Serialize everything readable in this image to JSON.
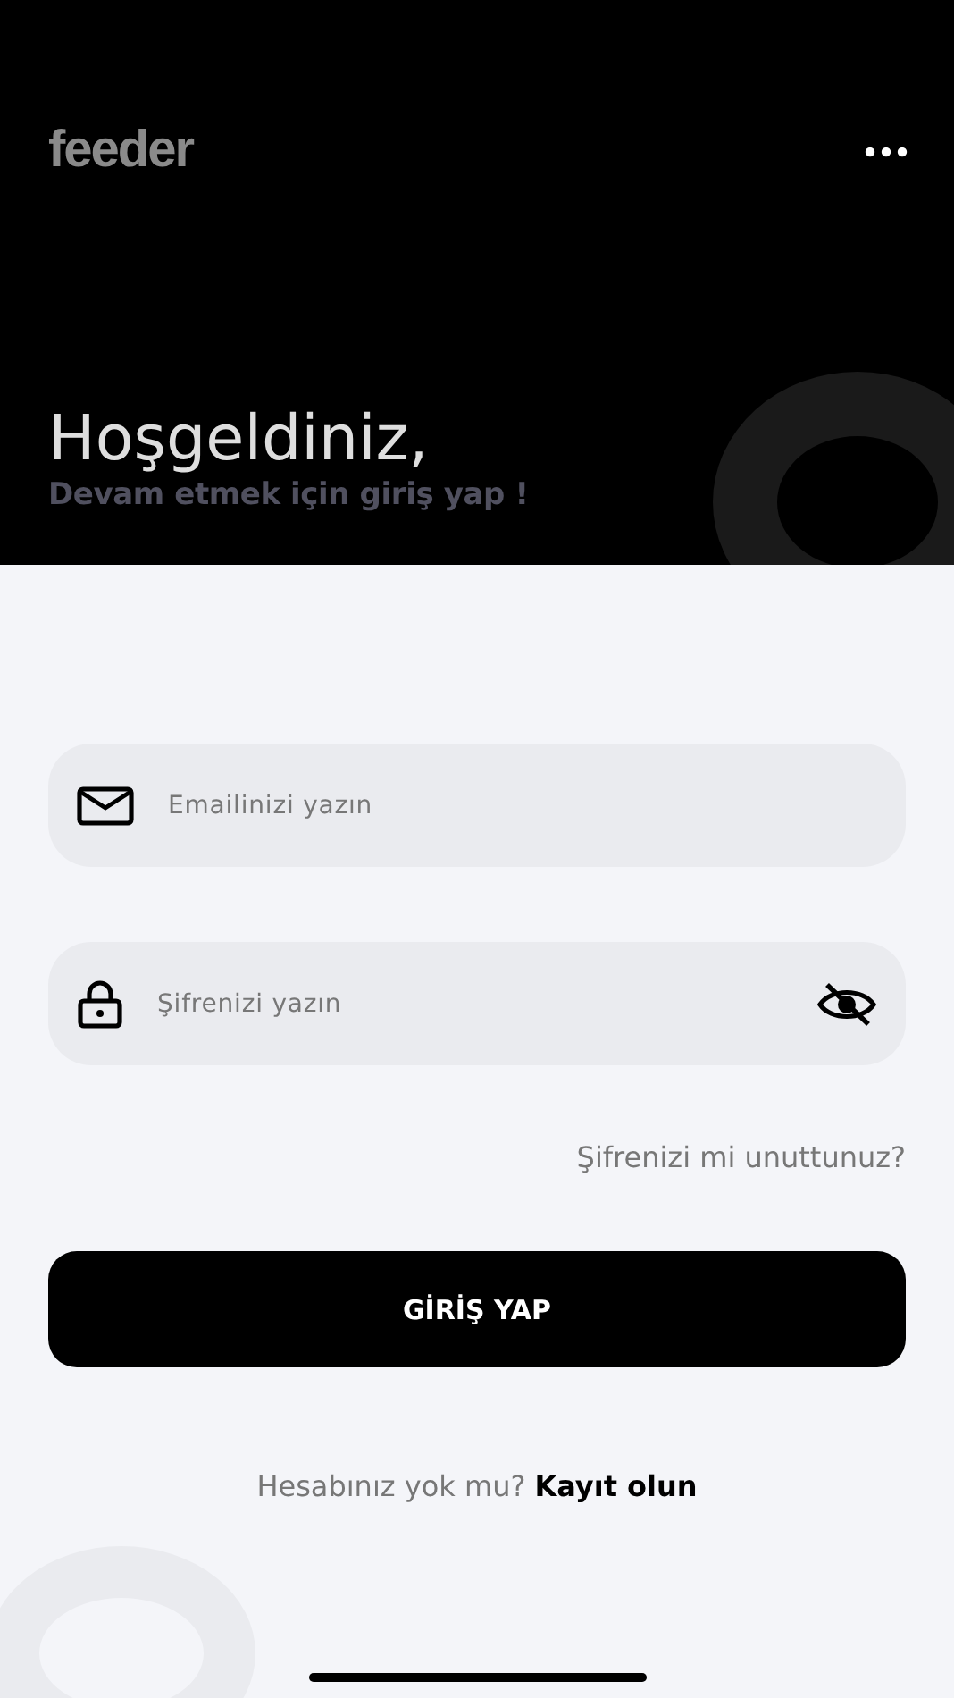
{
  "header": {
    "logo": "feeder",
    "title": "Hoşgeldiniz,",
    "subtitle": "Devam etmek için giriş yap !"
  },
  "form": {
    "email": {
      "placeholder": "Emailinizi yazın"
    },
    "password": {
      "placeholder": "Şifrenizi yazın",
      "visible": false
    },
    "forgot_link": "Şifrenizi mi unuttunuz?",
    "login_button": "GİRİŞ YAP",
    "signup_prompt": "Hesabınız yok mu?",
    "signup_link": "Kayıt olun"
  }
}
